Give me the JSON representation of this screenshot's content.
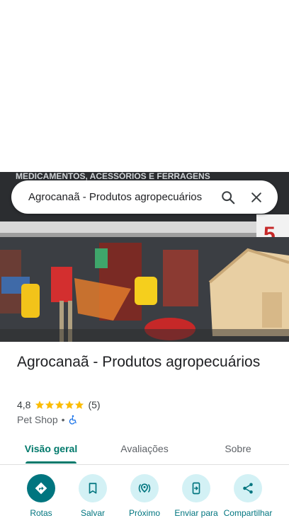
{
  "search": {
    "query": "Agrocanaã - Produtos agropecuários"
  },
  "photo": {
    "storefront_sign_text": "MEDICAMENTOS, ACESSÓRIOS E FERRAGENS",
    "sign_number": "5"
  },
  "place": {
    "title": "Agrocanaã - Produtos agropecuários",
    "rating": "4,8",
    "stars": 5,
    "review_count": "(5)",
    "category": "Pet Shop",
    "separator": "•"
  },
  "tabs": [
    {
      "label": "Visão geral",
      "active": true
    },
    {
      "label": "Avaliações",
      "active": false
    },
    {
      "label": "Sobre",
      "active": false
    }
  ],
  "actions": [
    {
      "label": "Rotas",
      "icon": "directions-icon"
    },
    {
      "label": "Salvar",
      "icon": "bookmark-icon"
    },
    {
      "label": "Próximo",
      "icon": "nearby-icon"
    },
    {
      "label": "Enviar para",
      "icon": "send-to-phone-icon"
    },
    {
      "label": "Compartilhar",
      "icon": "share-icon"
    }
  ],
  "colors": {
    "accent": "#00796b",
    "action_bg": "#d3f1f5",
    "action_primary": "#00757f",
    "star": "#fbbc04",
    "accessible_icon": "#1a73e8"
  }
}
